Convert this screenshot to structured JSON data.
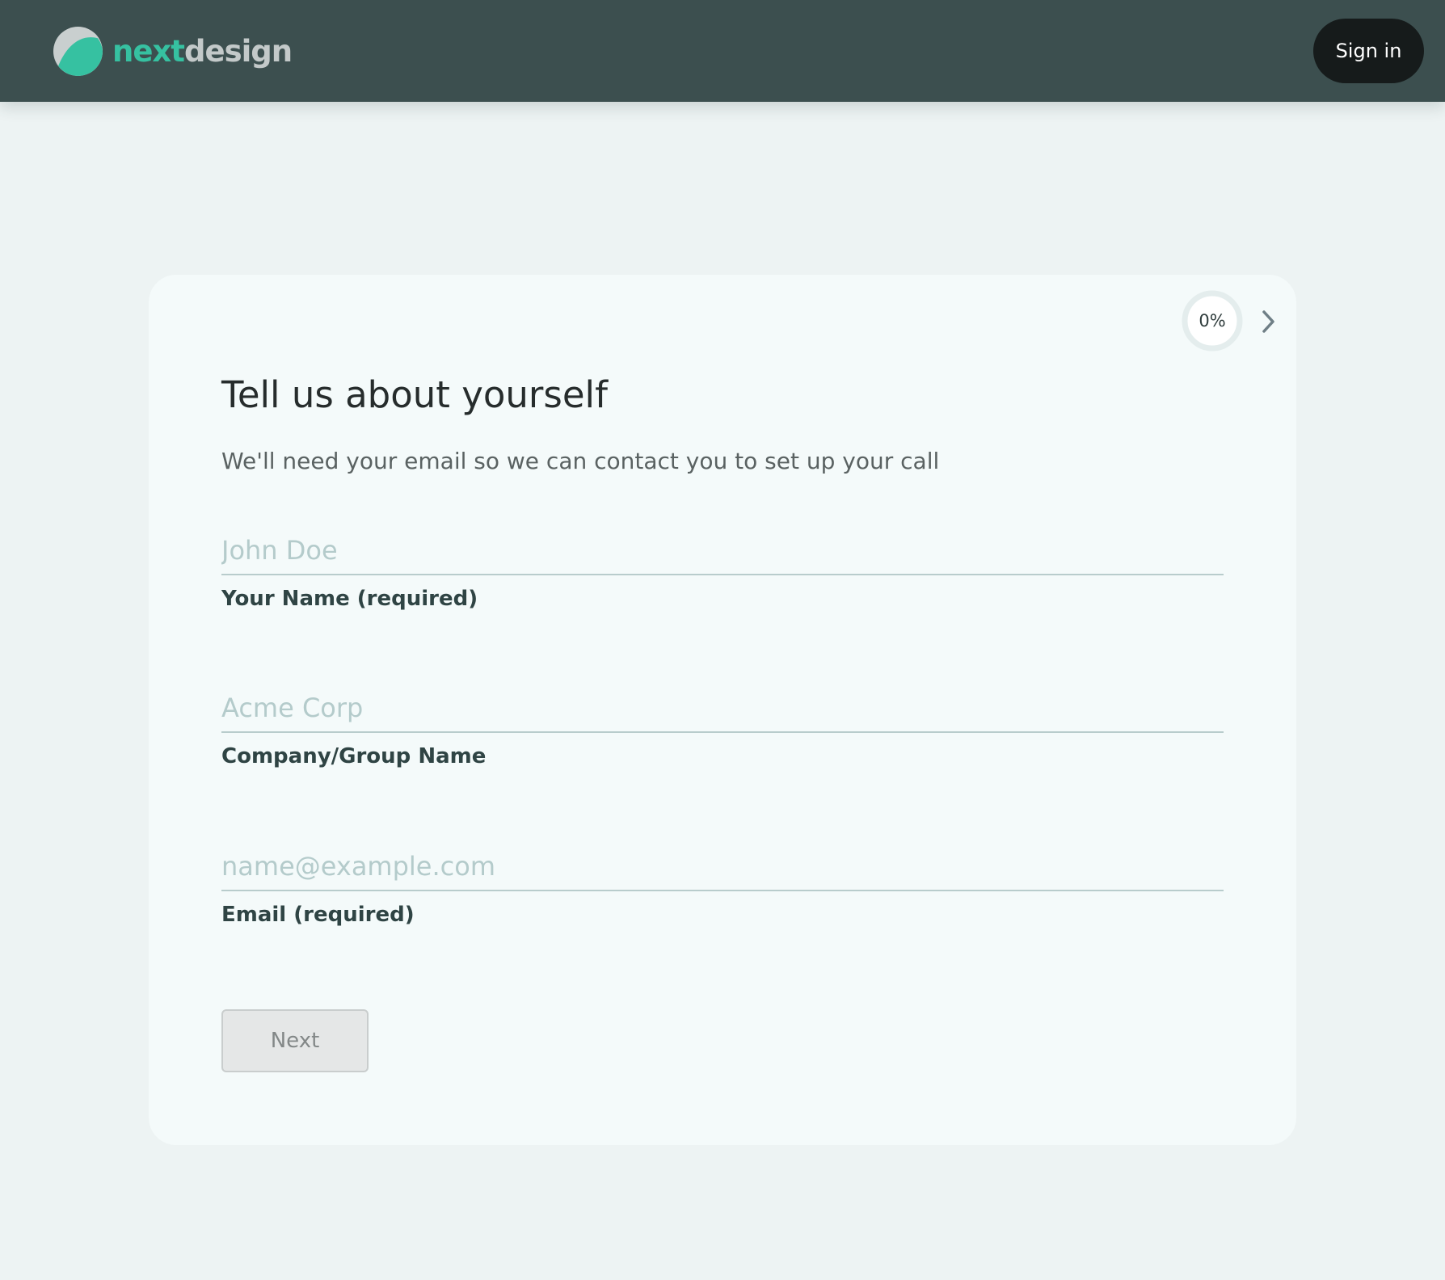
{
  "header": {
    "logo_part1": "next",
    "logo_part2": "design",
    "signin_label": "Sign in"
  },
  "progress": {
    "text": "0%",
    "value": 0
  },
  "form": {
    "title": "Tell us about yourself",
    "subtitle": "We'll need your email so we can contact you to set up your call",
    "fields": [
      {
        "placeholder": "John Doe",
        "value": "",
        "label": "Your Name (required)"
      },
      {
        "placeholder": "Acme Corp",
        "value": "",
        "label": "Company/Group Name"
      },
      {
        "placeholder": "name@example.com",
        "value": "",
        "label": "Email (required)"
      }
    ],
    "next_label": "Next"
  },
  "colors": {
    "header_bg": "#3c4f4f",
    "accent": "#36c1a1",
    "signin_bg": "#161b1b",
    "page_bg": "#edf3f3",
    "card_bg": "#f4fafa"
  },
  "icons": {
    "logo": "leaf-circle-icon",
    "next_step": "chevron-right-icon"
  }
}
